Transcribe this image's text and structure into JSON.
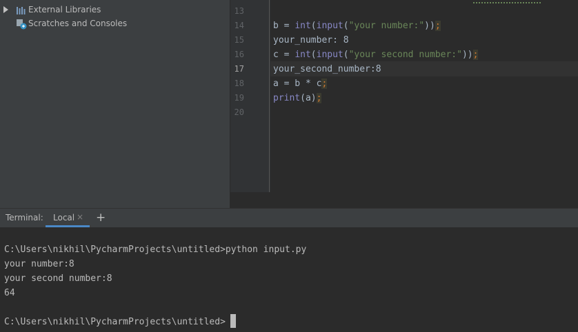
{
  "project_tree": {
    "items": [
      {
        "label": "External Libraries",
        "icon": "library-icon"
      },
      {
        "label": "Scratches and Consoles",
        "icon": "scratches-icon"
      }
    ]
  },
  "editor": {
    "line_numbers": [
      "13",
      "14",
      "15",
      "16",
      "17",
      "18",
      "19",
      "20"
    ],
    "current_line": "17",
    "lines": [
      {
        "segments": []
      },
      {
        "segments": [
          {
            "t": "b = ",
            "c": "plain"
          },
          {
            "t": "int",
            "c": "kw"
          },
          {
            "t": "(",
            "c": "plain"
          },
          {
            "t": "input",
            "c": "kw"
          },
          {
            "t": "(",
            "c": "plain"
          },
          {
            "t": "\"your number:\"",
            "c": "str"
          },
          {
            "t": "))",
            "c": "plain"
          },
          {
            "t": ";",
            "c": "semi"
          }
        ]
      },
      {
        "segments": [
          {
            "t": "your_number: 8",
            "c": "plain"
          }
        ]
      },
      {
        "segments": [
          {
            "t": "c = ",
            "c": "plain"
          },
          {
            "t": "int",
            "c": "kw"
          },
          {
            "t": "(",
            "c": "plain"
          },
          {
            "t": "input",
            "c": "kw"
          },
          {
            "t": "(",
            "c": "plain"
          },
          {
            "t": "\"your second number:\"",
            "c": "str"
          },
          {
            "t": "))",
            "c": "plain"
          },
          {
            "t": ";",
            "c": "semi"
          }
        ]
      },
      {
        "segments": [
          {
            "t": "your_second_number:8",
            "c": "plain"
          }
        ]
      },
      {
        "segments": [
          {
            "t": "a = b * c",
            "c": "plain"
          },
          {
            "t": ";",
            "c": "semi"
          }
        ]
      },
      {
        "segments": [
          {
            "t": "print",
            "c": "kw"
          },
          {
            "t": "(a)",
            "c": "plain"
          },
          {
            "t": ";",
            "c": "semi"
          }
        ]
      },
      {
        "segments": []
      }
    ]
  },
  "terminal": {
    "title": "Terminal:",
    "tab_label": "Local",
    "close_glyph": "×",
    "add_glyph": "+",
    "output": [
      "C:\\Users\\nikhil\\PycharmProjects\\untitled>python input.py",
      "your number:8",
      "your second number:8",
      "64",
      "",
      "C:\\Users\\nikhil\\PycharmProjects\\untitled>"
    ]
  },
  "colors": {
    "keyword": "#8888c6",
    "string": "#6a8759",
    "semicolon": "#cc7832",
    "accent": "#4a88c7"
  }
}
